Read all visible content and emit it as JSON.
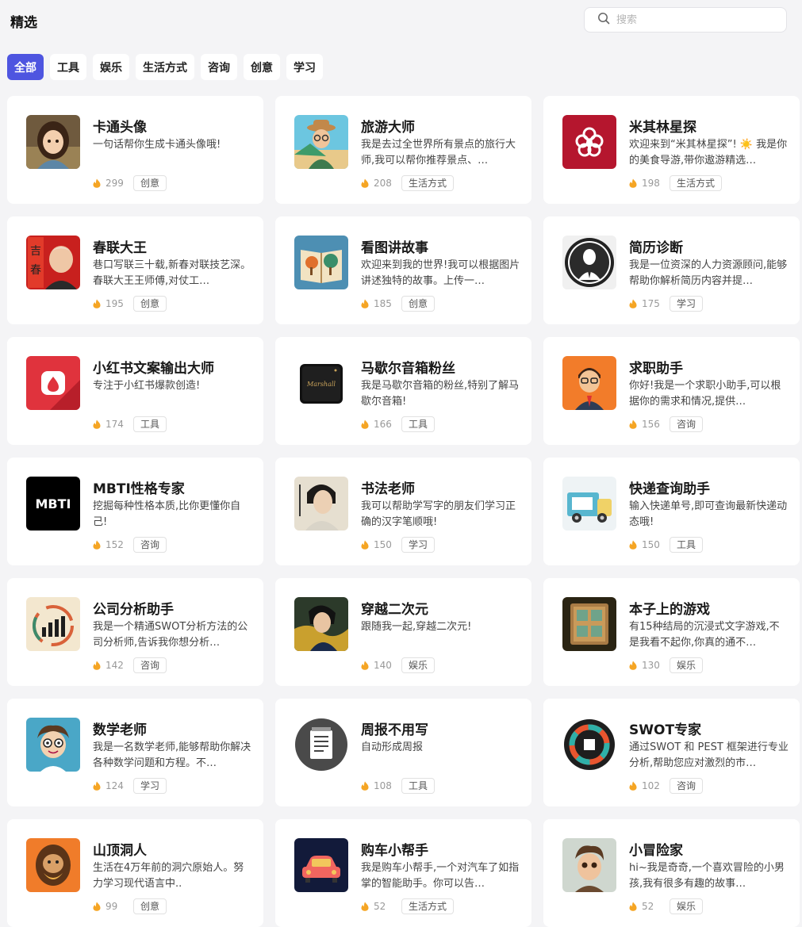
{
  "header": {
    "title": "精选",
    "search_placeholder": "搜索"
  },
  "tabs": [
    {
      "label": "全部",
      "active": true
    },
    {
      "label": "工具",
      "active": false
    },
    {
      "label": "娱乐",
      "active": false
    },
    {
      "label": "生活方式",
      "active": false
    },
    {
      "label": "咨询",
      "active": false
    },
    {
      "label": "创意",
      "active": false
    },
    {
      "label": "学习",
      "active": false
    }
  ],
  "colors": {
    "accent": "#4e55e0",
    "fire": "#f5a524",
    "background": "#f4f4f6"
  },
  "cards": [
    {
      "title": "卡通头像",
      "desc": "一句话帮你生成卡通头像哦!",
      "count": "299",
      "tag": "创意",
      "icon": "cartoon-girl-avatar-icon"
    },
    {
      "title": "旅游大师",
      "desc": "我是去过全世界所有景点的旅行大师,我可以帮你推荐景点、…",
      "count": "208",
      "tag": "生活方式",
      "icon": "traveler-avatar-icon"
    },
    {
      "title": "米其林星探",
      "desc": "欢迎来到“米其林星探”! ☀️ 我是你的美食导游,带你遨游精选…",
      "count": "198",
      "tag": "生活方式",
      "icon": "michelin-star-icon"
    },
    {
      "title": "春联大王",
      "desc": "巷口写联三十载,新春对联技艺深。春联大王王师傅,对仗工…",
      "count": "195",
      "tag": "创意",
      "icon": "old-man-couplet-icon"
    },
    {
      "title": "看图讲故事",
      "desc": "欢迎来到我的世界!我可以根据图片讲述独特的故事。上传一…",
      "count": "185",
      "tag": "创意",
      "icon": "storybook-icon"
    },
    {
      "title": "简历诊断",
      "desc": "我是一位资深的人力资源顾问,能够帮助你解析简历内容并提…",
      "count": "175",
      "tag": "学习",
      "icon": "businessman-silhouette-icon"
    },
    {
      "title": "小红书文案输出大师",
      "desc": "专注于小红书爆款创造!",
      "count": "174",
      "tag": "工具",
      "icon": "red-note-icon"
    },
    {
      "title": "马歇尔音箱粉丝",
      "desc": "我是马歇尔音箱的粉丝,特别了解马歇尔音箱!",
      "count": "166",
      "tag": "工具",
      "icon": "speaker-icon"
    },
    {
      "title": "求职助手",
      "desc": "你好!我是一个求职小助手,可以根据你的需求和情况,提供…",
      "count": "156",
      "tag": "咨询",
      "icon": "job-seeker-avatar-icon"
    },
    {
      "title": "MBTI性格专家",
      "desc": "挖掘每种性格本质,比你更懂你自己!",
      "count": "152",
      "tag": "咨询",
      "icon": "mbti-logo-icon"
    },
    {
      "title": "书法老师",
      "desc": "我可以帮助学写字的朋友们学习正确的汉字笔顺哦!",
      "count": "150",
      "tag": "学习",
      "icon": "calligrapher-avatar-icon"
    },
    {
      "title": "快递查询助手",
      "desc": "输入快递单号,即可查询最新快递动态哦!",
      "count": "150",
      "tag": "工具",
      "icon": "delivery-truck-icon"
    },
    {
      "title": "公司分析助手",
      "desc": "我是一个精通SWOT分析方法的公司分析师,告诉我你想分析…",
      "count": "142",
      "tag": "咨询",
      "icon": "bar-chart-icon"
    },
    {
      "title": "穿越二次元",
      "desc": "跟随我一起,穿越二次元!",
      "count": "140",
      "tag": "娱乐",
      "icon": "anime-character-icon"
    },
    {
      "title": "本子上的游戏",
      "desc": "有15种结局的沉浸式文字游戏,不是我看不起你,你真的通不…",
      "count": "130",
      "tag": "娱乐",
      "icon": "board-game-icon"
    },
    {
      "title": "数学老师",
      "desc": "我是一名数学老师,能够帮助你解决各种数学问题和方程。不…",
      "count": "124",
      "tag": "学习",
      "icon": "teacher-avatar-icon"
    },
    {
      "title": "周报不用写",
      "desc": "自动形成周报",
      "count": "108",
      "tag": "工具",
      "icon": "notepad-icon"
    },
    {
      "title": "SWOT专家",
      "desc": "通过SWOT 和 PEST 框架进行专业分析,帮助您应对激烈的市…",
      "count": "102",
      "tag": "咨询",
      "icon": "swot-logo-icon"
    },
    {
      "title": "山顶洞人",
      "desc": "生活在4万年前的洞穴原始人。努力学习现代语言中..",
      "count": "99",
      "tag": "创意",
      "icon": "caveman-avatar-icon"
    },
    {
      "title": "购车小帮手",
      "desc": "我是购车小帮手,一个对汽车了如指掌的智能助手。你可以告…",
      "count": "52",
      "tag": "生活方式",
      "icon": "car-icon"
    },
    {
      "title": "小冒险家",
      "desc": "hi~我是奇奇,一个喜欢冒险的小男孩,我有很多有趣的故事…",
      "count": "52",
      "tag": "娱乐",
      "icon": "boy-adventurer-icon"
    }
  ]
}
